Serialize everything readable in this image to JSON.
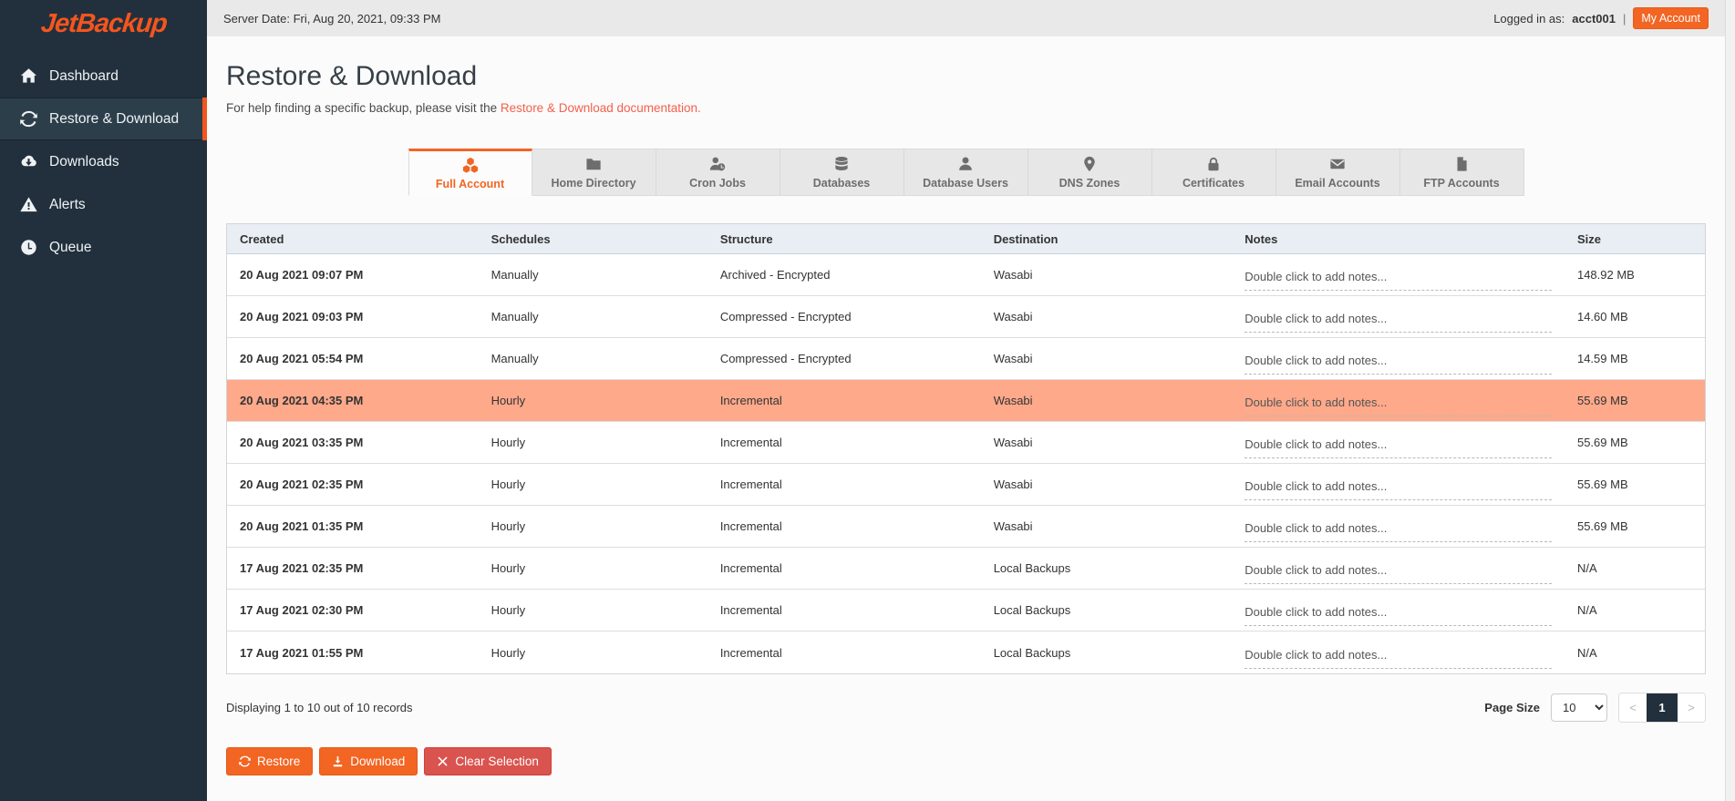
{
  "colors": {
    "accent": "#f26522",
    "logo_orange": "#f4551e",
    "sidebar_bg": "#22303d",
    "sidebar_active_bg": "#2d3e4b",
    "highlight_row": "#fda98a",
    "danger": "#d9534f",
    "link": "#f4604c",
    "table_header_bg": "#e9eef4",
    "pager_active_bg": "#22303d"
  },
  "topbar": {
    "server_date": "Server Date: Fri, Aug 20, 2021, 09:33 PM",
    "logged_in_label": "Logged in as:",
    "username": "acct001",
    "separator": "|",
    "my_account_label": "My Account"
  },
  "sidebar": {
    "logo": "JetBackup",
    "items": [
      {
        "label": "Dashboard",
        "icon": "home-icon",
        "active": false
      },
      {
        "label": "Restore & Download",
        "icon": "sync-icon",
        "active": true
      },
      {
        "label": "Downloads",
        "icon": "cloud-download-icon",
        "active": false
      },
      {
        "label": "Alerts",
        "icon": "alert-triangle-icon",
        "active": false
      },
      {
        "label": "Queue",
        "icon": "clock-icon",
        "active": false
      }
    ]
  },
  "page": {
    "title": "Restore & Download",
    "help_text": "For help finding a specific backup, please visit the ",
    "help_link": "Restore & Download documentation."
  },
  "tabs": [
    {
      "label": "Full Account",
      "icon": "cubes-icon",
      "active": true
    },
    {
      "label": "Home Directory",
      "icon": "folder-icon",
      "active": false
    },
    {
      "label": "Cron Jobs",
      "icon": "user-clock-icon",
      "active": false
    },
    {
      "label": "Databases",
      "icon": "database-icon",
      "active": false
    },
    {
      "label": "Database Users",
      "icon": "user-icon",
      "active": false
    },
    {
      "label": "DNS Zones",
      "icon": "map-marker-icon",
      "active": false
    },
    {
      "label": "Certificates",
      "icon": "lock-icon",
      "active": false
    },
    {
      "label": "Email Accounts",
      "icon": "envelope-icon",
      "active": false
    },
    {
      "label": "FTP Accounts",
      "icon": "file-icon",
      "active": false
    }
  ],
  "table": {
    "columns": [
      "Created",
      "Schedules",
      "Structure",
      "Destination",
      "Notes",
      "Size"
    ],
    "notes_placeholder": "Double click to add notes...",
    "rows": [
      {
        "created": "20 Aug 2021 09:07 PM",
        "schedules": "Manually",
        "structure": "Archived - Encrypted",
        "destination": "Wasabi",
        "size": "148.92 MB",
        "highlighted": false
      },
      {
        "created": "20 Aug 2021 09:03 PM",
        "schedules": "Manually",
        "structure": "Compressed - Encrypted",
        "destination": "Wasabi",
        "size": "14.60 MB",
        "highlighted": false
      },
      {
        "created": "20 Aug 2021 05:54 PM",
        "schedules": "Manually",
        "structure": "Compressed - Encrypted",
        "destination": "Wasabi",
        "size": "14.59 MB",
        "highlighted": false
      },
      {
        "created": "20 Aug 2021 04:35 PM",
        "schedules": "Hourly",
        "structure": "Incremental",
        "destination": "Wasabi",
        "size": "55.69 MB",
        "highlighted": true
      },
      {
        "created": "20 Aug 2021 03:35 PM",
        "schedules": "Hourly",
        "structure": "Incremental",
        "destination": "Wasabi",
        "size": "55.69 MB",
        "highlighted": false
      },
      {
        "created": "20 Aug 2021 02:35 PM",
        "schedules": "Hourly",
        "structure": "Incremental",
        "destination": "Wasabi",
        "size": "55.69 MB",
        "highlighted": false
      },
      {
        "created": "20 Aug 2021 01:35 PM",
        "schedules": "Hourly",
        "structure": "Incremental",
        "destination": "Wasabi",
        "size": "55.69 MB",
        "highlighted": false
      },
      {
        "created": "17 Aug 2021 02:35 PM",
        "schedules": "Hourly",
        "structure": "Incremental",
        "destination": "Local Backups",
        "size": "N/A",
        "highlighted": false
      },
      {
        "created": "17 Aug 2021 02:30 PM",
        "schedules": "Hourly",
        "structure": "Incremental",
        "destination": "Local Backups",
        "size": "N/A",
        "highlighted": false
      },
      {
        "created": "17 Aug 2021 01:55 PM",
        "schedules": "Hourly",
        "structure": "Incremental",
        "destination": "Local Backups",
        "size": "N/A",
        "highlighted": false
      }
    ]
  },
  "footer": {
    "records_text": "Displaying 1 to 10 out of 10 records",
    "page_size_label": "Page Size",
    "page_size_value": "10",
    "prev_label": "<",
    "page_label": "1",
    "next_label": ">"
  },
  "actions": [
    {
      "label": "Restore",
      "icon": "restore-icon",
      "style": "orange"
    },
    {
      "label": "Download",
      "icon": "download-icon",
      "style": "orange"
    },
    {
      "label": "Clear Selection",
      "icon": "clear-icon",
      "style": "red"
    }
  ]
}
